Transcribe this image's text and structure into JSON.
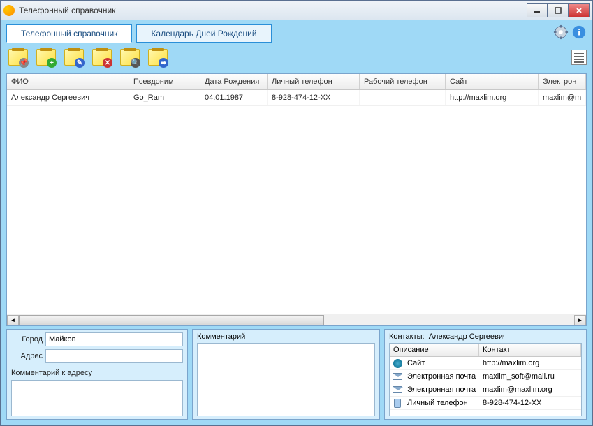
{
  "window": {
    "title": "Телефонный справочник"
  },
  "tabs": {
    "phonebook": "Телефонный справочник",
    "calendar": "Календарь Дней Рождений"
  },
  "columns": {
    "fio": "ФИО",
    "nick": "Псевдоним",
    "dob": "Дата Рождения",
    "pphone": "Личный телефон",
    "wphone": "Рабочий телефон",
    "site": "Сайт",
    "email": "Электрон"
  },
  "rows": [
    {
      "fio": "Александр Сергеевич",
      "nick": "Go_Ram",
      "dob": "04.01.1987",
      "pphone": "8-928-474-12-XX",
      "wphone": "",
      "site": "http://maxlim.org",
      "email": "maxlim@m"
    }
  ],
  "details": {
    "city_label": "Город",
    "city_value": "Майкоп",
    "address_label": "Адрес",
    "address_value": "",
    "addr_comment_label": "Комментарий к адресу",
    "comment_label": "Комментарий",
    "contacts_prefix": "Контакты:",
    "contacts_name": "Александр Сергеевич"
  },
  "contacts_table": {
    "col_desc": "Описание",
    "col_val": "Контакт",
    "rows": [
      {
        "icon": "globe",
        "desc": "Сайт",
        "val": "http://maxlim.org"
      },
      {
        "icon": "mail",
        "desc": "Электронная почта",
        "val": "maxlim_soft@mail.ru"
      },
      {
        "icon": "mail",
        "desc": "Электронная почта",
        "val": "maxlim@maxlim.org"
      },
      {
        "icon": "phone",
        "desc": "Личный телефон",
        "val": "8-928-474-12-XX"
      }
    ]
  }
}
